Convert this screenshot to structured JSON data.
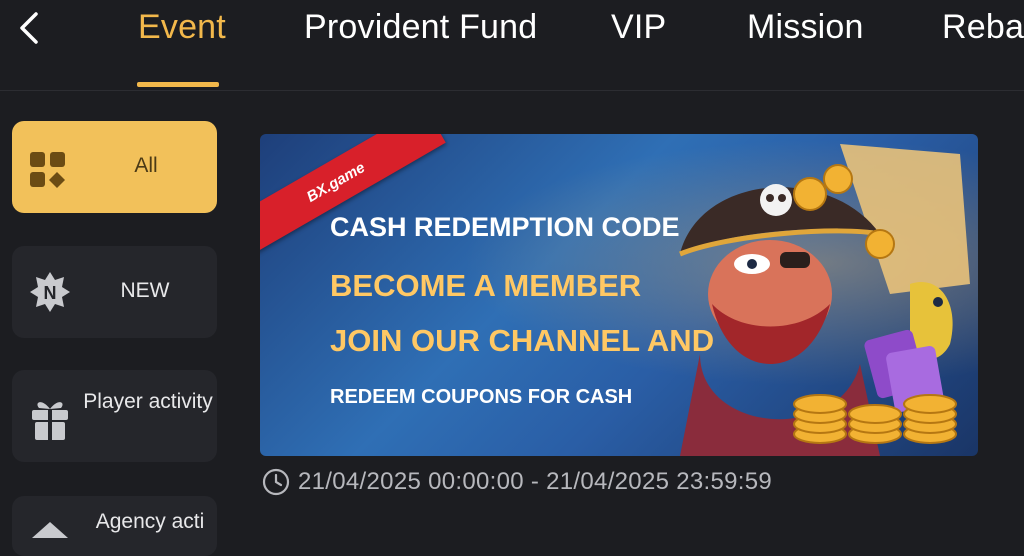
{
  "header": {
    "tabs": [
      {
        "label": "Event",
        "active": true
      },
      {
        "label": "Provident Fund"
      },
      {
        "label": "VIP"
      },
      {
        "label": "Mission"
      },
      {
        "label": "Reba"
      }
    ]
  },
  "sidebar": {
    "items": [
      {
        "label": "All",
        "icon": "grid-icon",
        "active": true
      },
      {
        "label": "NEW",
        "icon": "new-badge-icon"
      },
      {
        "label": "Player activity",
        "icon": "gift-icon"
      },
      {
        "label": "Agency acti",
        "icon": "agency-icon"
      }
    ]
  },
  "banner": {
    "ribbon": "BX.game",
    "line1": "CASH REDEMPTION CODE",
    "line2": "BECOME A MEMBER",
    "line3": "JOIN OUR CHANNEL AND",
    "line4": "REDEEM COUPONS FOR CASH"
  },
  "event": {
    "date_range": "21/04/2025 00:00:00 - 21/04/2025 23:59:59"
  },
  "colors": {
    "accent": "#f2b84b",
    "background": "#1c1d21",
    "card": "#25262b"
  }
}
